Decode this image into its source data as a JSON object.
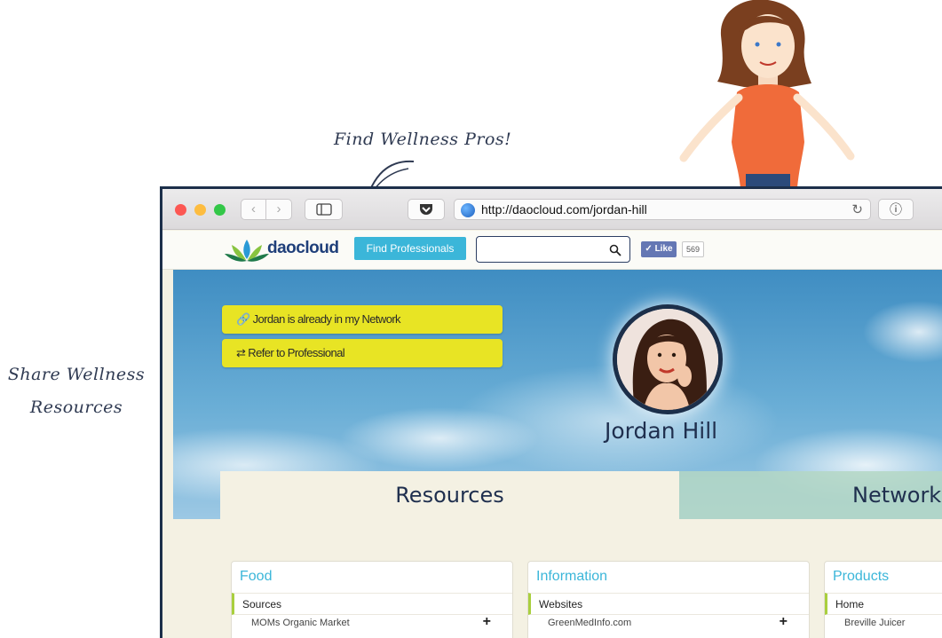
{
  "annotations": {
    "top": "Find Wellness Pros!",
    "left_line1": "Share Wellness",
    "left_line2": "Resources"
  },
  "browser": {
    "url": "http://daocloud.com/jordan-hill",
    "back_icon": "‹",
    "forward_icon": "›",
    "reload_icon": "↻",
    "info_icon": "ⓘ"
  },
  "site": {
    "logo_text": "daocloud",
    "find_button": "Find Professionals",
    "search_placeholder": "",
    "like_label": "✓ Like",
    "like_count": "569"
  },
  "profile": {
    "network_button": "Jordan is already in my Network",
    "refer_button": "Refer to Professional",
    "name": "Jordan Hill"
  },
  "tabs": {
    "resources": "Resources",
    "network": "Network"
  },
  "cards": [
    {
      "title": "Food",
      "subheading": "Sources",
      "item": "MOMs Organic Market"
    },
    {
      "title": "Information",
      "subheading": "Websites",
      "item": "GreenMedInfo.com"
    },
    {
      "title": "Products",
      "subheading": "Home",
      "item": "Breville Juicer"
    }
  ],
  "colors": {
    "accent": "#3bb6d9",
    "yellow_button": "#e8e424",
    "navy": "#1c2f4a",
    "green_marker": "#a9cf3e"
  }
}
